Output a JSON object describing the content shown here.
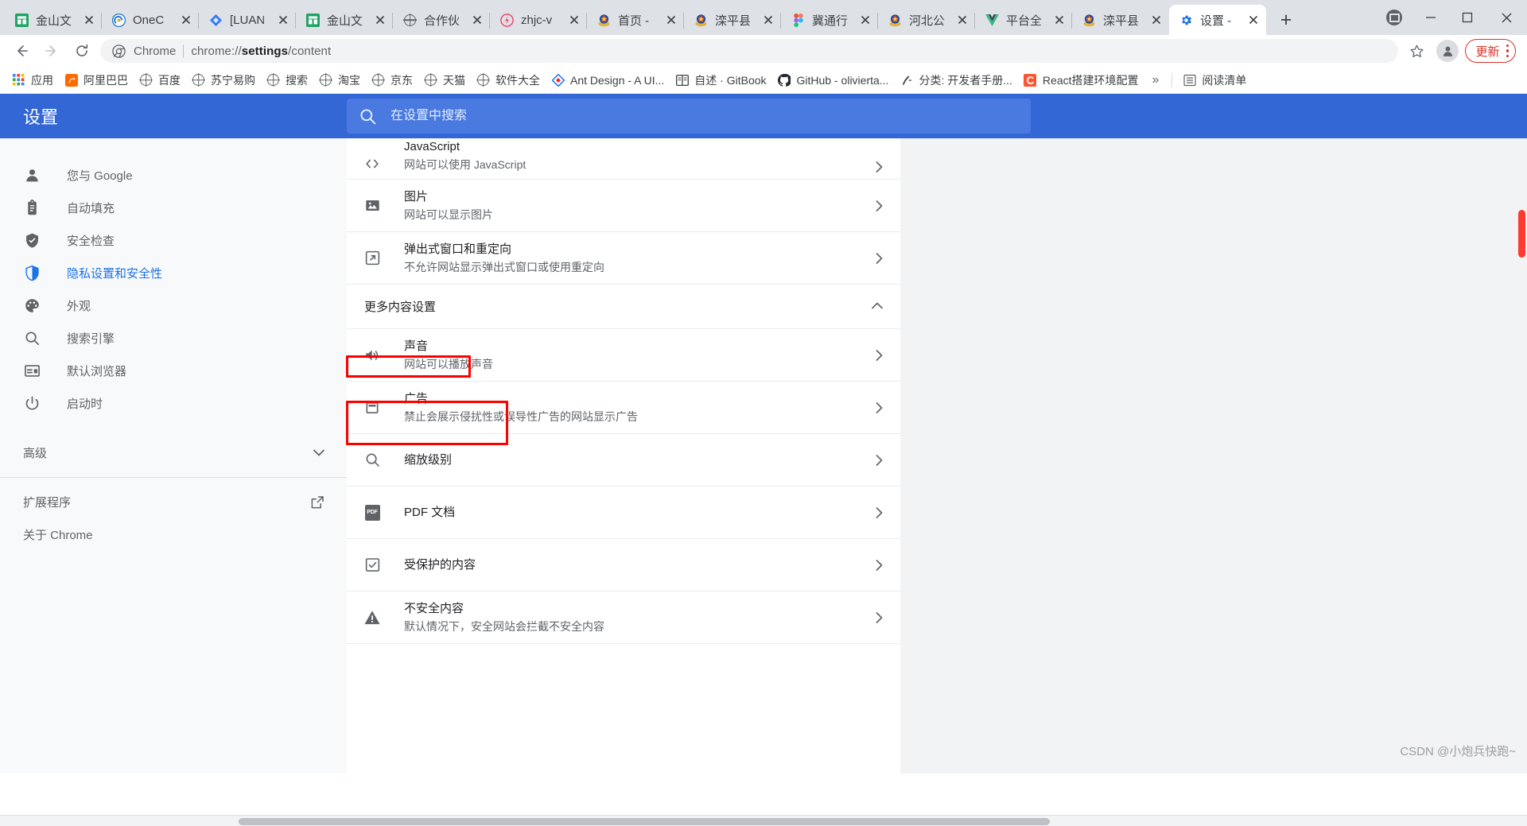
{
  "window": {
    "controls": {
      "cast": "cast-icon",
      "minimize": "–",
      "maximize": "▢",
      "close": "✕"
    },
    "new_tab_label": "+"
  },
  "tabs": [
    {
      "title": "金山文",
      "favicon": "kingsoft-icon",
      "active": false
    },
    {
      "title": "OneC",
      "favicon": "onenote-icon",
      "active": false
    },
    {
      "title": "[LUAN",
      "favicon": "diamond-icon",
      "active": false
    },
    {
      "title": "金山文",
      "favicon": "kingsoft-icon",
      "active": false
    },
    {
      "title": "合作伙",
      "favicon": "globe-icon",
      "active": false
    },
    {
      "title": "zhjc-v",
      "favicon": "zhjc-icon",
      "active": false
    },
    {
      "title": "首页 -",
      "favicon": "police-icon",
      "active": false
    },
    {
      "title": "滦平县",
      "favicon": "police-icon",
      "active": false
    },
    {
      "title": "冀通行",
      "favicon": "figma-icon",
      "active": false
    },
    {
      "title": "河北公",
      "favicon": "police-icon",
      "active": false
    },
    {
      "title": "平台全",
      "favicon": "vue-icon",
      "active": false
    },
    {
      "title": "滦平县",
      "favicon": "police-icon",
      "active": false
    },
    {
      "title": "设置 -",
      "favicon": "gear-icon",
      "active": true
    }
  ],
  "toolbar": {
    "back": "←",
    "forward": "→",
    "reload": "⟳",
    "omnibox": {
      "chrome_label": "Chrome",
      "url_prefix": "chrome://",
      "url_bold": "settings",
      "url_suffix": "/content"
    },
    "bookmark_star": "☆",
    "update_label": "更新"
  },
  "bookmarks": {
    "apps_label": "应用",
    "items": [
      {
        "label": "阿里巴巴",
        "icon": "alibaba-icon"
      },
      {
        "label": "百度",
        "icon": "globe-icon"
      },
      {
        "label": "苏宁易购",
        "icon": "globe-icon"
      },
      {
        "label": "搜索",
        "icon": "globe-icon"
      },
      {
        "label": "淘宝",
        "icon": "globe-icon"
      },
      {
        "label": "京东",
        "icon": "globe-icon"
      },
      {
        "label": "天猫",
        "icon": "globe-icon"
      },
      {
        "label": "软件大全",
        "icon": "globe-icon"
      },
      {
        "label": "Ant Design - A UI...",
        "icon": "antdesign-icon"
      },
      {
        "label": "自述 · GitBook",
        "icon": "gitbook-icon"
      },
      {
        "label": "GitHub - olivierta...",
        "icon": "github-icon"
      },
      {
        "label": "分类: 开发者手册...",
        "icon": "doc-icon"
      },
      {
        "label": "React搭建环境配置",
        "icon": "csdn-icon"
      }
    ],
    "overflow": "»",
    "reading_list": "阅读清单"
  },
  "settings": {
    "title": "设置",
    "search_placeholder": "在设置中搜索",
    "search_value": "",
    "sidebar": [
      {
        "label": "您与 Google",
        "icon": "person-icon",
        "active": false
      },
      {
        "label": "自动填充",
        "icon": "clipboard-icon",
        "active": false
      },
      {
        "label": "安全检查",
        "icon": "shield-check-icon",
        "active": false
      },
      {
        "label": "隐私设置和安全性",
        "icon": "shield-icon",
        "active": true
      },
      {
        "label": "外观",
        "icon": "palette-icon",
        "active": false
      },
      {
        "label": "搜索引擎",
        "icon": "search-icon",
        "active": false
      },
      {
        "label": "默认浏览器",
        "icon": "browser-icon",
        "active": false
      },
      {
        "label": "启动时",
        "icon": "power-icon",
        "active": false
      }
    ],
    "advanced_label": "高级",
    "extensions_label": "扩展程序",
    "about_label": "关于 Chrome",
    "rows_top": [
      {
        "title": "JavaScript",
        "sub": "网站可以使用 JavaScript",
        "icon": "code-icon",
        "partial": true
      },
      {
        "title": "图片",
        "sub": "网站可以显示图片",
        "icon": "image-icon",
        "partial": false
      },
      {
        "title": "弹出式窗口和重定向",
        "sub": "不允许网站显示弹出式窗口或使用重定向",
        "icon": "popup-icon",
        "partial": false
      }
    ],
    "section_more": "更多内容设置",
    "rows_more": [
      {
        "title": "声音",
        "sub": "网站可以播放声音",
        "icon": "sound-icon",
        "highlight": true
      },
      {
        "title": "广告",
        "sub": "禁止会展示侵扰性或误导性广告的网站显示广告",
        "icon": "ad-icon",
        "highlight": false
      },
      {
        "title": "缩放级别",
        "sub": "",
        "icon": "zoom-icon",
        "highlight": false
      },
      {
        "title": "PDF 文档",
        "sub": "",
        "icon": "pdf-icon",
        "highlight": false
      },
      {
        "title": "受保护的内容",
        "sub": "",
        "icon": "protected-icon",
        "highlight": false
      },
      {
        "title": "不安全内容",
        "sub": "默认情况下，安全网站会拦截不安全内容",
        "icon": "warning-icon",
        "highlight": false
      }
    ],
    "arrow": "▸",
    "collapse_caret": "▴"
  },
  "watermark": "CSDN @小炮兵快跑~",
  "colors": {
    "accent": "#3367d6",
    "active_link": "#1a73e8",
    "annotation": "#ff0000",
    "update": "#d93025",
    "scroll_thumb": "#ff3b30"
  }
}
